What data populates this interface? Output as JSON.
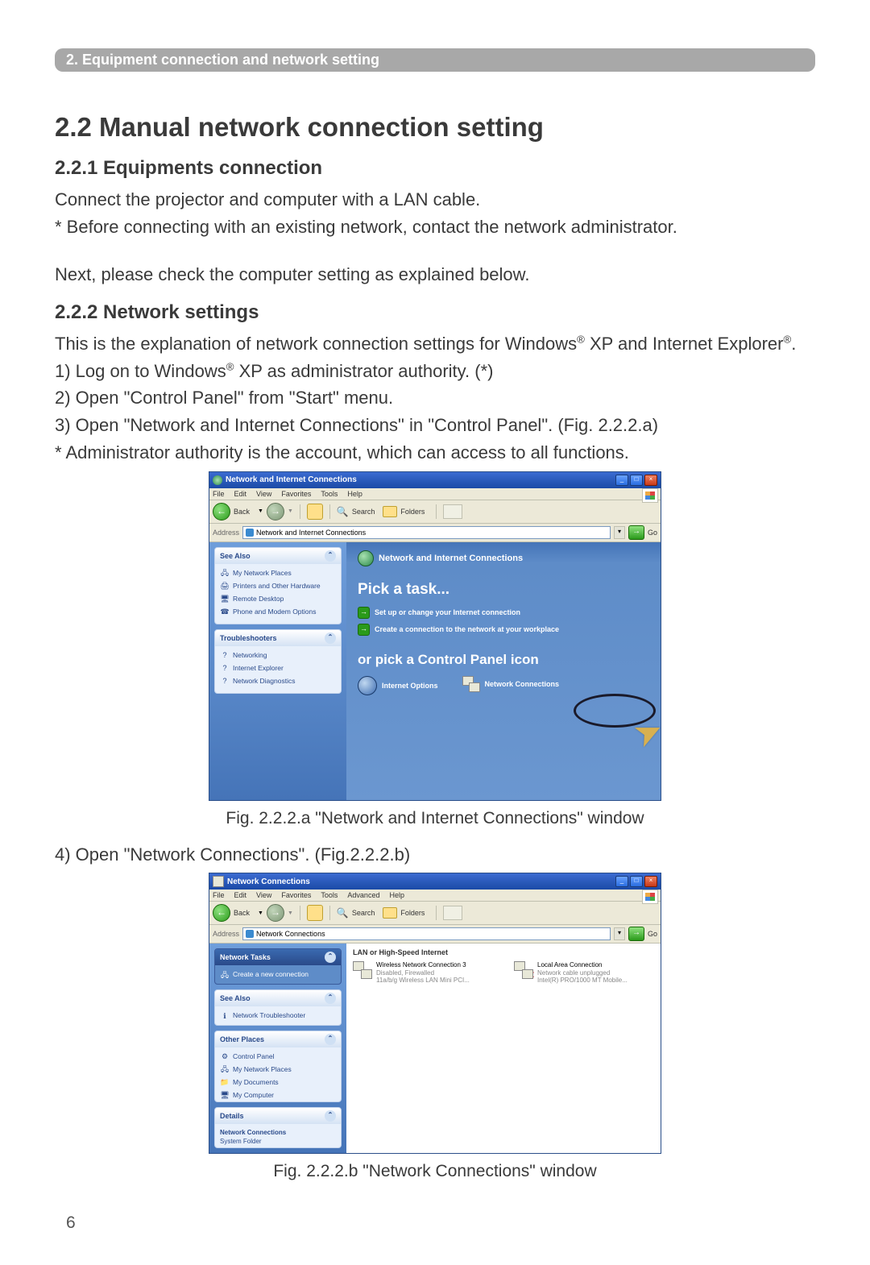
{
  "chapter_bar": "2. Equipment connection and network setting",
  "section_title": "2.2 Manual network connection setting",
  "sub1_title": "2.2.1 Equipments connection",
  "p1": "Connect the projector and computer with a LAN cable.",
  "p2": "* Before connecting with an existing network, contact the network administrator.",
  "p3": "Next, please check the computer setting as explained below.",
  "sub2_title": "2.2.2 Network settings",
  "p4a": "This is the explanation of network connection settings for Windows",
  "p4b": " XP and Internet Explorer",
  "p4c": ".",
  "step1a": "1) Log on to Windows",
  "step1b": " XP as administrator authority. (*)",
  "step2": "2) Open \"Control Panel\" from \"Start\" menu.",
  "step3": "3) Open \"Network and Internet Connections\" in \"Control Panel\". (Fig. 2.2.2.a)",
  "note1": "* Administrator authority is the account, which can access to all functions.",
  "caption_a": "Fig. 2.2.2.a \"Network and Internet Connections\" window",
  "step4": "4) Open \"Network Connections\". (Fig.2.2.2.b)",
  "caption_b": "Fig. 2.2.2.b \"Network Connections\" window",
  "page_number": "6",
  "winA": {
    "title": "Network and Internet Connections",
    "menu": {
      "file": "File",
      "edit": "Edit",
      "view": "View",
      "favorites": "Favorites",
      "tools": "Tools",
      "help": "Help"
    },
    "toolbar": {
      "back": "Back",
      "search": "Search",
      "folders": "Folders"
    },
    "addressbar": {
      "label": "Address",
      "value": "Network and Internet Connections",
      "go": "Go"
    },
    "side": {
      "see_also": {
        "title": "See Also",
        "items": [
          "My Network Places",
          "Printers and Other Hardware",
          "Remote Desktop",
          "Phone and Modem Options"
        ]
      },
      "troubleshooters": {
        "title": "Troubleshooters",
        "items": [
          "Networking",
          "Internet Explorer",
          "Network Diagnostics"
        ]
      }
    },
    "main": {
      "category_title": "Network and Internet Connections",
      "pick_task": "Pick a task...",
      "task1": "Set up or change your Internet connection",
      "task2": "Create a connection to the network at your workplace",
      "or_pick": "or pick a Control Panel icon",
      "icon1": "Internet Options",
      "icon2": "Network Connections"
    }
  },
  "winB": {
    "title": "Network Connections",
    "menu": {
      "file": "File",
      "edit": "Edit",
      "view": "View",
      "favorites": "Favorites",
      "tools": "Tools",
      "advanced": "Advanced",
      "help": "Help"
    },
    "toolbar": {
      "back": "Back",
      "search": "Search",
      "folders": "Folders"
    },
    "addressbar": {
      "label": "Address",
      "value": "Network Connections",
      "go": "Go"
    },
    "side": {
      "network_tasks": {
        "title": "Network Tasks",
        "items": [
          "Create a new connection"
        ]
      },
      "see_also": {
        "title": "See Also",
        "items": [
          "Network Troubleshooter"
        ]
      },
      "other_places": {
        "title": "Other Places",
        "items": [
          "Control Panel",
          "My Network Places",
          "My Documents",
          "My Computer"
        ]
      },
      "details": {
        "title": "Details",
        "name": "Network Connections",
        "type": "System Folder"
      }
    },
    "main": {
      "section": "LAN or High-Speed Internet",
      "item1": {
        "name": "Wireless Network Connection 3",
        "status": "Disabled, Firewalled",
        "device": "11a/b/g Wireless LAN Mini PCI..."
      },
      "item2": {
        "name": "Local Area Connection",
        "status": "Network cable unplugged",
        "device": "Intel(R) PRO/1000 MT Mobile..."
      }
    }
  }
}
